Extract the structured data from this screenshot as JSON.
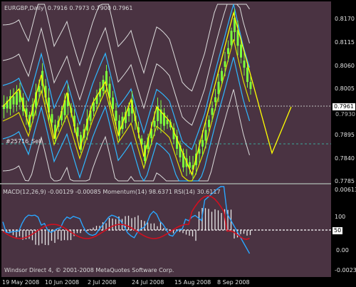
{
  "main": {
    "title": "EURGBP,Daily",
    "ohlc": "0.7916 0.7973 0.7900 0.7961",
    "label_annotation": "#25716_Sell",
    "price_ticks": [
      "0.8170",
      "0.8115",
      "0.8060",
      "0.8005",
      "0.7950",
      "0.7895",
      "0.7840",
      "0.7785"
    ],
    "current_price": "0.7961",
    "level_label": "0.7930"
  },
  "indicator": {
    "header": "MACD(12,26,9) -0.00129 -0.00085  Momentum(14) 98.6371  RSI(14) 30.6117",
    "ticks": [
      "0.00613",
      "100",
      "50",
      "0.00",
      "-0.00239"
    ],
    "level_bubble": "50",
    "footer": "Windsor Direct 4, © 2001-2008 MetaQuotes Software Corp."
  },
  "time_axis": [
    "19 May 2008",
    "10 Jun 2008",
    "2 Jul 2008",
    "24 Jul 2008",
    "15 Aug 2008",
    "8 Sep 2008"
  ],
  "colors": {
    "background": "#4a3342",
    "candle": "#7cff3c",
    "zigzag": "#ffff00",
    "band_blue": "#2fb8ff",
    "band_white": "#dcdcdc",
    "ma_yellow": "#e0e000",
    "macd_blue": "#2aa6ff",
    "rsi_red": "#d01020",
    "hist": "#e8e8e8"
  }
}
